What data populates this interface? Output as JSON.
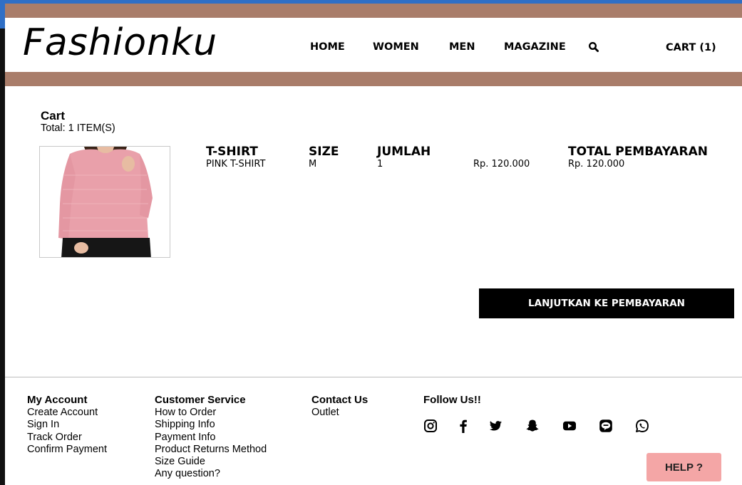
{
  "brand": {
    "logo_text": "Fashionku",
    "band_color": "#a97d6a"
  },
  "nav": {
    "home": "HOME",
    "women": "WOMEN",
    "men": "MEN",
    "magazine": "MAGAZINE",
    "search_icon": "search-icon",
    "cart": "CART (1)"
  },
  "cart": {
    "title": "Cart",
    "total_items": "Total: 1 ITEM(S)",
    "headers": {
      "product": "T-SHIRT",
      "size": "SIZE",
      "qty": "JUMLAH",
      "total": "TOTAL PEMBAYARAN"
    },
    "item": {
      "name": "PINK T-SHIRT",
      "size": "M",
      "qty": "1",
      "price": "Rp. 120.000",
      "total": "Rp. 120.000",
      "image_desc": "pink-tshirt-photo"
    },
    "checkout_label": "LANJUTKAN KE PEMBAYARAN"
  },
  "footer": {
    "account": {
      "heading": "My Account",
      "links": [
        "Create Account",
        "Sign In",
        "Track Order",
        "Confirm Payment"
      ]
    },
    "service": {
      "heading": "Customer Service",
      "links": [
        "How to Order",
        "Shipping Info",
        "Payment Info",
        "Product Returns Method",
        "Size Guide",
        "Any question?"
      ]
    },
    "contact": {
      "heading": "Contact Us",
      "links": [
        "Outlet"
      ]
    },
    "follow": {
      "heading": "Follow Us!!",
      "icons": [
        "instagram-icon",
        "facebook-icon",
        "twitter-icon",
        "snapchat-icon",
        "youtube-icon",
        "line-icon",
        "whatsapp-icon"
      ]
    }
  },
  "help": {
    "label": "HELP ?",
    "color": "#f4a6a6"
  }
}
